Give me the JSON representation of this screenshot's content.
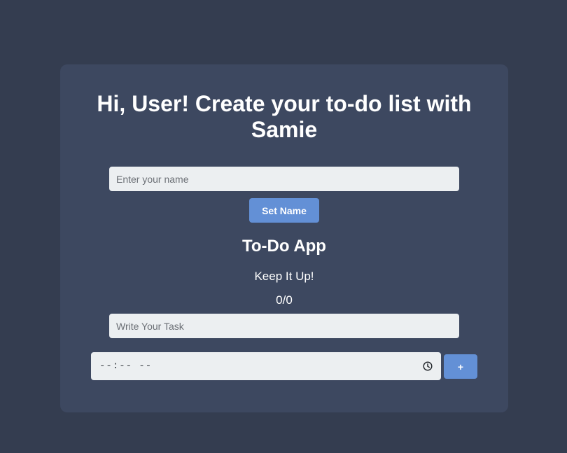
{
  "header": {
    "title": "Hi, User! Create your to-do list with Samie"
  },
  "name_form": {
    "placeholder": "Enter your name",
    "value": "",
    "button_label": "Set Name"
  },
  "app": {
    "heading": "To-Do App",
    "motivation": "Keep It Up!",
    "progress_text": "0/0"
  },
  "task_form": {
    "placeholder": "Write Your Task",
    "value": "",
    "time_display": "--:-- --",
    "time_icon": "clock-icon",
    "add_label": "+"
  },
  "colors": {
    "page_bg": "#343d50",
    "card_bg": "#3d4860",
    "input_bg": "#eceff1",
    "accent": "#6390d6",
    "text": "#ffffff"
  }
}
